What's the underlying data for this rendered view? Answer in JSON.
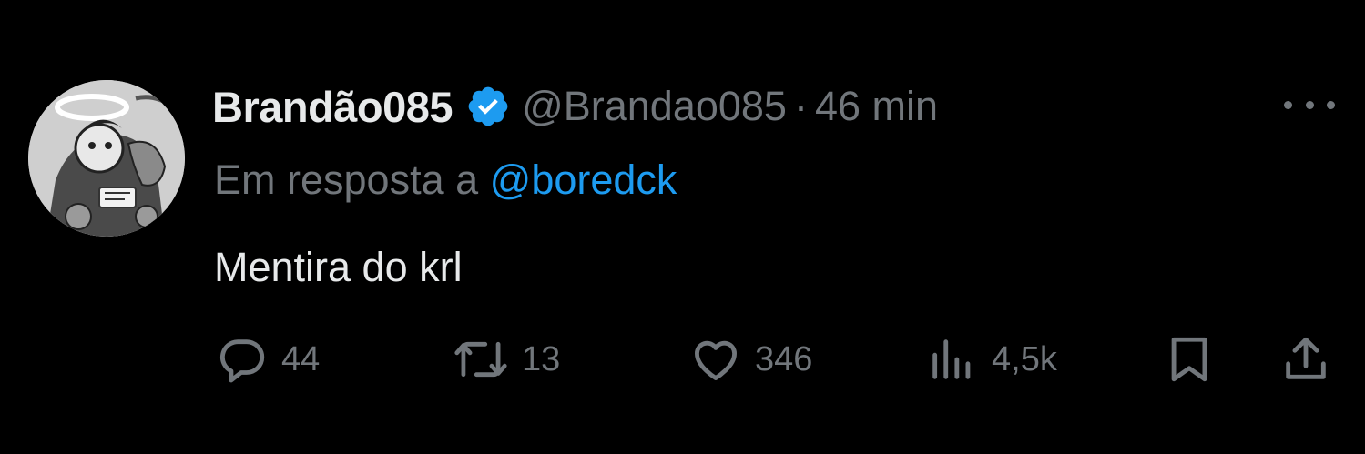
{
  "user": {
    "display_name": "Brandão085",
    "handle": "@Brandao085",
    "separator": "·",
    "time": "46 min",
    "verified": true
  },
  "reply": {
    "prefix": "Em resposta a",
    "mention": "@boredck"
  },
  "tweet": {
    "text": "Mentira do krl"
  },
  "actions": {
    "replies": "44",
    "retweets": "13",
    "likes": "346",
    "views": "4,5k"
  },
  "colors": {
    "background": "#000000",
    "primary_text": "#e7e9ea",
    "secondary_text": "#71767b",
    "accent": "#1d9bf0"
  },
  "icons": {
    "more": "more-horizontal-icon",
    "verified": "verified-badge-icon",
    "reply": "reply-icon",
    "retweet": "retweet-icon",
    "like": "heart-icon",
    "views": "views-icon",
    "bookmark": "bookmark-icon",
    "share": "share-icon"
  }
}
